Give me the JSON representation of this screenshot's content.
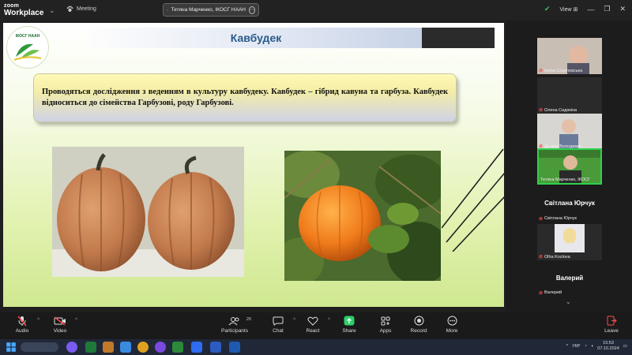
{
  "titlebar": {
    "brand_top": "zoom",
    "brand_bottom": "Workplace",
    "meeting_label": "Meeting",
    "share_label": "Тетяна Марченко, ІКОСГ НААН",
    "view_label": "View",
    "shield_color": "#3fbf5f"
  },
  "slide": {
    "logo_text": "ІКОСГ НААН",
    "title": "Кавбудек",
    "body": "Проводяться дослідження з веденням в культуру кавбудеку. Кавбудек – гібрид кавуна та гарбуза. Кавбудек відноситься до сімейства Гарбузові, роду Гарбузові."
  },
  "participants": {
    "tiles": [
      {
        "name": "Ірина Соколовська",
        "type": "video"
      },
      {
        "name": "Олена Сидякіна",
        "type": "video"
      },
      {
        "name": "Дьомін Володимир",
        "type": "video"
      },
      {
        "name": "Тетяна Марченко, ІКОСГ",
        "type": "video",
        "active": true
      },
      {
        "name": "Світлана Юрчук",
        "display": "Світлана Юрчук",
        "type": "name"
      },
      {
        "name": "Olha Kozlova",
        "type": "video"
      },
      {
        "name": "Валерий",
        "display": "Валерий",
        "type": "name"
      }
    ],
    "active_color": "#2fd14d",
    "muted_color": "#ff4a4a"
  },
  "toolbar": {
    "audio": "Audio",
    "video": "Video",
    "participants": "Participants",
    "participants_count": "20",
    "chat": "Chat",
    "react": "React",
    "share": "Share",
    "apps": "Apps",
    "record": "Record",
    "more": "More",
    "leave": "Leave",
    "share_color": "#2fcf6a"
  },
  "taskbar": {
    "lang": "УКР",
    "time": "15:53",
    "date": "07.10.2024"
  }
}
